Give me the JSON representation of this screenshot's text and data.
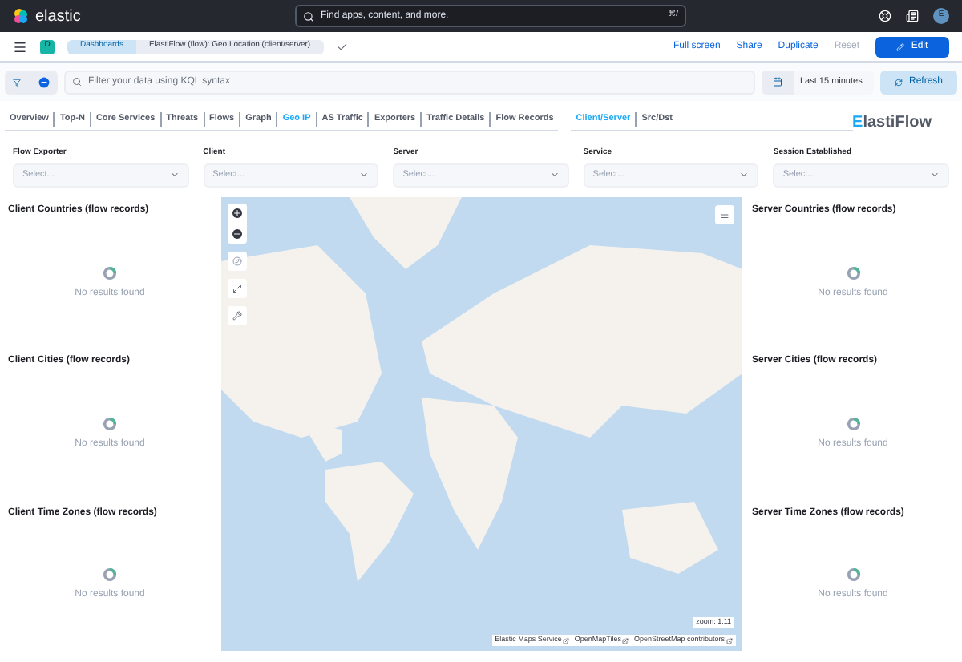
{
  "header": {
    "logo": "elastic",
    "search_placeholder": "Find apps, content, and more.",
    "shortcut": "⌘/",
    "avatar": "E"
  },
  "toolbar": {
    "space": "D",
    "breadcrumbs": [
      "Dashboards",
      "ElastiFlow (flow): Geo Location (client/server)"
    ],
    "actions": [
      {
        "label": "Full screen",
        "kind": "link",
        "disabled": false
      },
      {
        "label": "Share",
        "kind": "link",
        "disabled": false
      },
      {
        "label": "Duplicate",
        "kind": "link",
        "disabled": false
      },
      {
        "label": "Reset",
        "kind": "link",
        "disabled": true
      },
      {
        "label": "Edit",
        "kind": "primary",
        "disabled": false
      }
    ]
  },
  "query": {
    "placeholder": "Filter your data using KQL syntax",
    "time": "Last 15 minutes",
    "refresh": "Refresh"
  },
  "nav": [
    {
      "label": "Overview",
      "selected": false
    },
    {
      "label": "Top-N",
      "selected": false
    },
    {
      "label": "Core Services",
      "selected": false
    },
    {
      "label": "Threats",
      "selected": false
    },
    {
      "label": "Flows",
      "selected": false
    },
    {
      "label": "Graph",
      "selected": false
    },
    {
      "label": "Geo IP",
      "selected": true
    },
    {
      "label": "AS Traffic",
      "selected": false
    },
    {
      "label": "Exporters",
      "selected": false
    },
    {
      "label": "Traffic Details",
      "selected": false
    },
    {
      "label": "Flow Records",
      "selected": false
    }
  ],
  "subnav": [
    {
      "label": "Client/Server",
      "selected": true
    },
    {
      "label": "Src/Dst",
      "selected": false
    }
  ],
  "brand": "ElastiFlow",
  "controls": [
    {
      "label": "Flow Exporter",
      "placeholder": "Select..."
    },
    {
      "label": "Client",
      "placeholder": "Select..."
    },
    {
      "label": "Server",
      "placeholder": "Select..."
    },
    {
      "label": "Service",
      "placeholder": "Select..."
    },
    {
      "label": "Session Established",
      "placeholder": "Select..."
    }
  ],
  "left_panels": [
    {
      "title": "Client Countries (flow records)",
      "message": "No results found"
    },
    {
      "title": "Client Cities (flow records)",
      "message": "No results found"
    },
    {
      "title": "Client Time Zones (flow records)",
      "message": "No results found"
    }
  ],
  "right_panels": [
    {
      "title": "Server Countries (flow records)",
      "message": "No results found"
    },
    {
      "title": "Server Cities (flow records)",
      "message": "No results found"
    },
    {
      "title": "Server Time Zones (flow records)",
      "message": "No results found"
    }
  ],
  "map": {
    "zoom": "zoom: 1.11",
    "attribution": [
      "Elastic Maps Service",
      "OpenMapTiles",
      "OpenStreetMap contributors"
    ]
  }
}
